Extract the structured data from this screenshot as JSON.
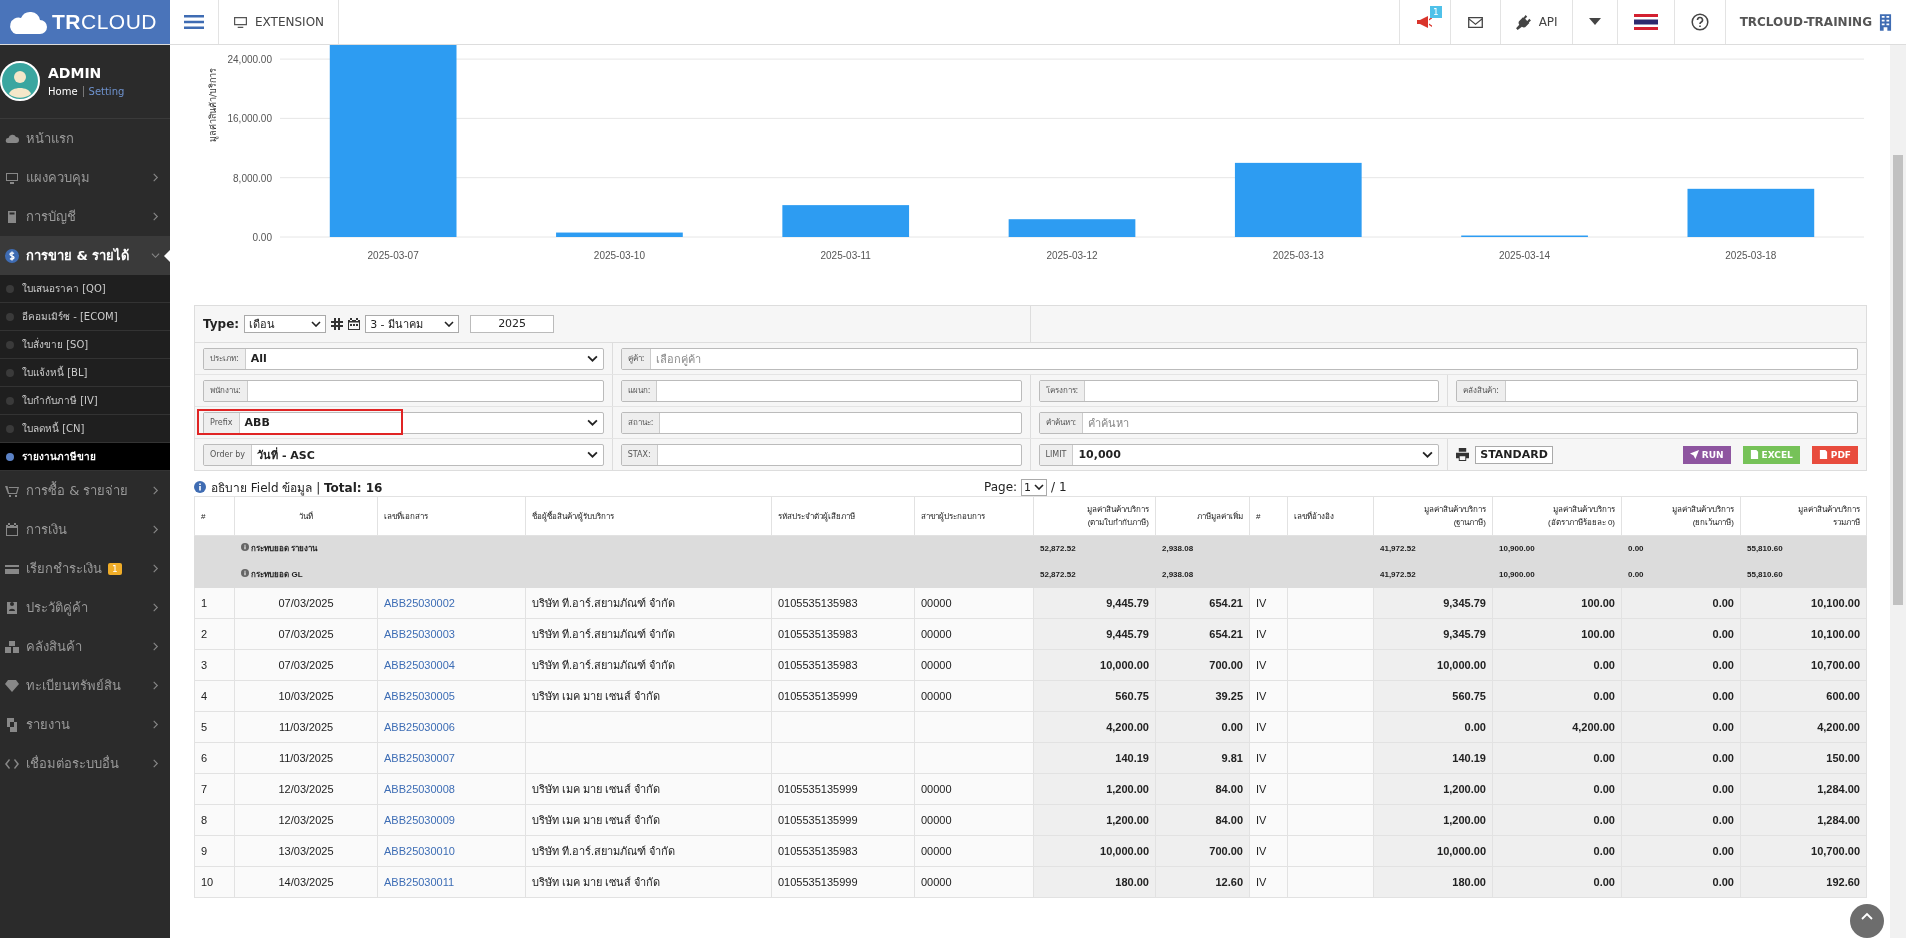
{
  "logo": {
    "text": "**TR**CLOUD"
  },
  "topbar": {
    "extension": "EXTENSION",
    "notification_count": "1",
    "api": "API",
    "company": "TRCLOUD-TRAINING"
  },
  "user": {
    "name": "ADMIN",
    "links": [
      {
        "label": "Home",
        "selected": true
      },
      {
        "label": "Setting",
        "selected": false
      }
    ]
  },
  "sidebar": {
    "items": [
      {
        "label": "หน้าแรก",
        "selected": false
      },
      {
        "label": "แผงควบคุม",
        "selected": false,
        "expanded": false
      },
      {
        "label": "การบัญชี",
        "selected": false,
        "expanded": false
      },
      {
        "label": "การขาย & รายได้",
        "selected": true,
        "expanded": true,
        "children": [
          {
            "label": "ใบเสนอราคา [QO]",
            "selected": false
          },
          {
            "label": "อีคอมเมิร์ซ - [ECOM]",
            "selected": false
          },
          {
            "label": "ใบสั่งขาย [SO]",
            "selected": false
          },
          {
            "label": "ใบแจ้งหนี้ [BL]",
            "selected": false
          },
          {
            "label": "ใบกำกับภาษี [IV]",
            "selected": false
          },
          {
            "label": "ใบลดหนี้ [CN]",
            "selected": false
          },
          {
            "label": "รายงานภาษีขาย",
            "selected": true
          }
        ]
      },
      {
        "label": "การซื้อ & รายจ่าย",
        "selected": false,
        "expanded": false
      },
      {
        "label": "การเงิน",
        "selected": false,
        "expanded": false
      },
      {
        "label": "เรียกชำระเงิน",
        "selected": false,
        "expanded": false,
        "badge": "1"
      },
      {
        "label": "ประวัติคู่ค้า",
        "selected": false,
        "expanded": false
      },
      {
        "label": "คลังสินค้า",
        "selected": false,
        "expanded": false
      },
      {
        "label": "ทะเบียนทรัพย์สิน",
        "selected": false,
        "expanded": false
      },
      {
        "label": "รายงาน",
        "selected": false,
        "expanded": false
      },
      {
        "label": "เชื่อมต่อระบบอื่น",
        "selected": false,
        "expanded": false
      }
    ]
  },
  "chart_data": {
    "type": "bar",
    "ylabel": "มูลค่าสินค้า/บริการ",
    "categories": [
      "2025-03-07",
      "2025-03-10",
      "2025-03-11",
      "2025-03-12",
      "2025-03-13",
      "2025-03-14",
      "2025-03-18"
    ],
    "values": [
      25900,
      600,
      4300,
      2400,
      10000,
      200,
      6500
    ],
    "ylim": [
      0,
      25900
    ],
    "grid": true,
    "yticks": [
      {
        "value": 0,
        "label": "0.00"
      },
      {
        "value": 8000,
        "label": "8,000.00"
      },
      {
        "value": 16000,
        "label": "16,000.00"
      },
      {
        "value": 24000,
        "label": "24,000.00"
      }
    ]
  },
  "period": {
    "type_label": "Type:",
    "type": "เดือน",
    "month": "3 - มีนาคม",
    "year": "2025"
  },
  "filter_rows": [
    [
      {
        "kind": "select",
        "label": "ประเภท:",
        "value": "All",
        "highlighted": false
      },
      {
        "kind": "input",
        "label": "คู่ค้า:",
        "placeholder": "เลือกคู่ค้า",
        "highlighted": false
      }
    ],
    [
      {
        "kind": "input",
        "label": "พนักงาน:",
        "highlighted": false
      },
      {
        "kind": "input",
        "label": "แผนก:",
        "highlighted": false
      },
      {
        "kind": "input",
        "label": "โครงการ:",
        "highlighted": false
      },
      {
        "kind": "input",
        "label": "คลังสินค้า:",
        "highlighted": false
      }
    ],
    [
      {
        "kind": "select",
        "label": "Prefix",
        "value": "ABB",
        "highlighted": true
      },
      {
        "kind": "input",
        "label": "สถานะ:",
        "highlighted": false
      },
      {
        "kind": "input",
        "label": "คำค้นหา:",
        "placeholder": "คำค้นหา",
        "highlighted": false
      }
    ],
    [
      {
        "kind": "select",
        "label": "Order by",
        "value": "วันที่ - ASC",
        "highlighted": false
      },
      {
        "kind": "input",
        "label": "STAX:",
        "highlighted": false
      },
      {
        "kind": "select",
        "label": "LIMIT",
        "value": "10,000",
        "highlighted": false
      },
      {
        "kind": "actions",
        "format": "STANDARD",
        "buttons": [
          {
            "label": "RUN",
            "color": "#8e55a0"
          },
          {
            "label": "EXCEL",
            "color": "#76c258"
          },
          {
            "label": "PDF",
            "color": "#e84c3d"
          }
        ]
      }
    ]
  ],
  "table": {
    "title": "อธิบาย Field ข้อมูล",
    "separator": "|",
    "total_label": "Total:",
    "total": "16",
    "page_label": "Page:",
    "page": "1",
    "page_of": "/ 1",
    "columns": [
      "#",
      "วันที่",
      "เลขที่เอกสาร",
      "ชื่อผู้ซื้อสินค้า/ผู้รับบริการ",
      "รหัสประจำตัวผู้เสียภาษี",
      "สาขาผู้ประกอบการ",
      "มูลค่าสินค้า/บริการ\n(ตามใบกำกับภาษี)",
      "ภาษีมูลค่าเพิ่ม",
      "#",
      "เลขที่อ้างอิง",
      "มูลค่าสินค้า/บริการ\n(ฐานภาษี)",
      "มูลค่าสินค้า/บริการ\n(อัตราภาษีร้อยละ 0)",
      "มูลค่าสินค้า/บริการ\n(ยกเว้นภาษี)",
      "มูลค่าสินค้า/บริการ\nรวมภาษี"
    ],
    "summary_rows": [
      {
        "label": "กระทบยอด รายงาน",
        "amount": "52,872.52",
        "vat": "2,938.08",
        "base": "41,972.52",
        "zero_rate": "10,900.00",
        "exempt": "0.00",
        "total": "55,810.60"
      },
      {
        "label": "กระทบยอด GL",
        "amount": "52,872.52",
        "vat": "2,938.08",
        "base": "41,972.52",
        "zero_rate": "10,900.00",
        "exempt": "0.00",
        "total": "55,810.60"
      }
    ],
    "rows": [
      {
        "no": "1",
        "date": "07/03/2025",
        "doc": "ABB25030002",
        "name": "บริษัท ที.อาร์.สยามภัณฑ์ จำกัด",
        "tax_id": "0105535135983",
        "branch": "00000",
        "amount": "9,445.79",
        "vat": "654.21",
        "type": "IV",
        "base": "9,345.79",
        "zero_rate": "100.00",
        "exempt": "0.00",
        "total": "10,100.00"
      },
      {
        "no": "2",
        "date": "07/03/2025",
        "doc": "ABB25030003",
        "name": "บริษัท ที.อาร์.สยามภัณฑ์ จำกัด",
        "tax_id": "0105535135983",
        "branch": "00000",
        "amount": "9,445.79",
        "vat": "654.21",
        "type": "IV",
        "base": "9,345.79",
        "zero_rate": "100.00",
        "exempt": "0.00",
        "total": "10,100.00"
      },
      {
        "no": "3",
        "date": "07/03/2025",
        "doc": "ABB25030004",
        "name": "บริษัท ที.อาร์.สยามภัณฑ์ จำกัด",
        "tax_id": "0105535135983",
        "branch": "00000",
        "amount": "10,000.00",
        "vat": "700.00",
        "type": "IV",
        "base": "10,000.00",
        "zero_rate": "0.00",
        "exempt": "0.00",
        "total": "10,700.00"
      },
      {
        "no": "4",
        "date": "10/03/2025",
        "doc": "ABB25030005",
        "name": "บริษัท เมค มาย เซนส์ จำกัด",
        "tax_id": "0105535135999",
        "branch": "00000",
        "amount": "560.75",
        "vat": "39.25",
        "type": "IV",
        "base": "560.75",
        "zero_rate": "0.00",
        "exempt": "0.00",
        "total": "600.00"
      },
      {
        "no": "5",
        "date": "11/03/2025",
        "doc": "ABB25030006",
        "amount": "4,200.00",
        "vat": "0.00",
        "type": "IV",
        "base": "0.00",
        "zero_rate": "4,200.00",
        "exempt": "0.00",
        "total": "4,200.00"
      },
      {
        "no": "6",
        "date": "11/03/2025",
        "doc": "ABB25030007",
        "amount": "140.19",
        "vat": "9.81",
        "type": "IV",
        "base": "140.19",
        "zero_rate": "0.00",
        "exempt": "0.00",
        "total": "150.00"
      },
      {
        "no": "7",
        "date": "12/03/2025",
        "doc": "ABB25030008",
        "name": "บริษัท เมค มาย เซนส์ จำกัด",
        "tax_id": "0105535135999",
        "branch": "00000",
        "amount": "1,200.00",
        "vat": "84.00",
        "type": "IV",
        "base": "1,200.00",
        "zero_rate": "0.00",
        "exempt": "0.00",
        "total": "1,284.00"
      },
      {
        "no": "8",
        "date": "12/03/2025",
        "doc": "ABB25030009",
        "name": "บริษัท เมค มาย เซนส์ จำกัด",
        "tax_id": "0105535135999",
        "branch": "00000",
        "amount": "1,200.00",
        "vat": "84.00",
        "type": "IV",
        "base": "1,200.00",
        "zero_rate": "0.00",
        "exempt": "0.00",
        "total": "1,284.00"
      },
      {
        "no": "9",
        "date": "13/03/2025",
        "doc": "ABB25030010",
        "name": "บริษัท ที.อาร์.สยามภัณฑ์ จำกัด",
        "tax_id": "0105535135983",
        "branch": "00000",
        "amount": "10,000.00",
        "vat": "700.00",
        "type": "IV",
        "base": "10,000.00",
        "zero_rate": "0.00",
        "exempt": "0.00",
        "total": "10,700.00"
      },
      {
        "no": "10",
        "date": "14/03/2025",
        "doc": "ABB25030011",
        "name": "บริษัท เมค มาย เซนส์ จำกัด",
        "tax_id": "0105535135999",
        "branch": "00000",
        "amount": "180.00",
        "vat": "12.60",
        "type": "IV",
        "base": "180.00",
        "zero_rate": "0.00",
        "exempt": "0.00",
        "total": "192.60"
      }
    ]
  }
}
